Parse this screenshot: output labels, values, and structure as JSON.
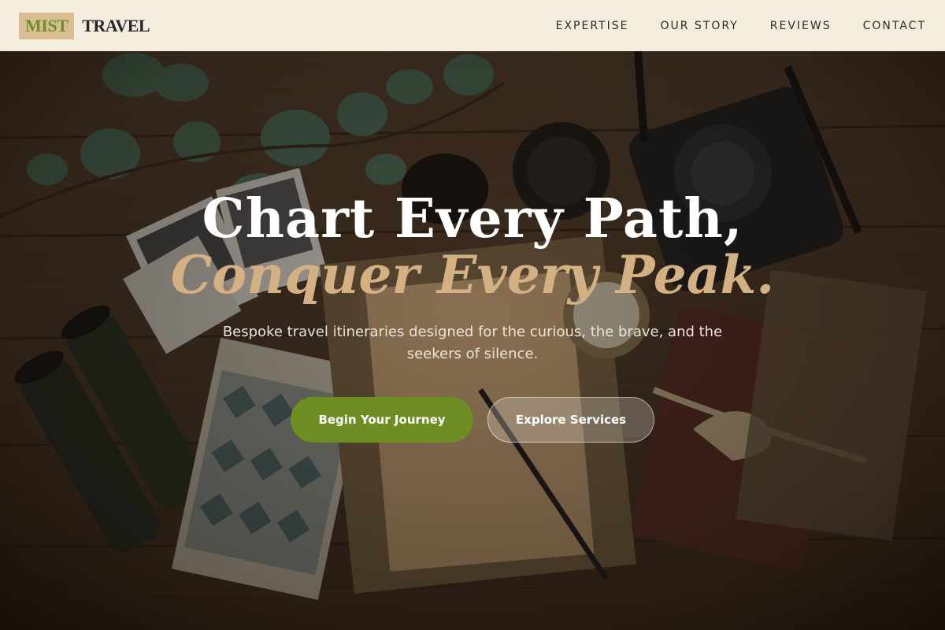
{
  "brand": {
    "mark": "MIST",
    "word": "TRAVEL"
  },
  "nav": {
    "items": [
      {
        "label": "EXPERTISE"
      },
      {
        "label": "OUR STORY"
      },
      {
        "label": "REVIEWS"
      },
      {
        "label": "CONTACT"
      }
    ]
  },
  "hero": {
    "headline_line1": "Chart Every Path,",
    "headline_line2": "Conquer Every Peak.",
    "subtitle": "Bespoke travel itineraries designed for the curious, the brave, and the seekers of silence.",
    "primary_cta": "Begin Your Journey",
    "secondary_cta": "Explore Services",
    "background_icon": "travel-flatlay-photo"
  },
  "colors": {
    "header_bg": "#f4ecdc",
    "accent_green": "#6e8d23",
    "accent_tan": "#d3b183",
    "logo_mark_bg": "#d8bc92"
  }
}
